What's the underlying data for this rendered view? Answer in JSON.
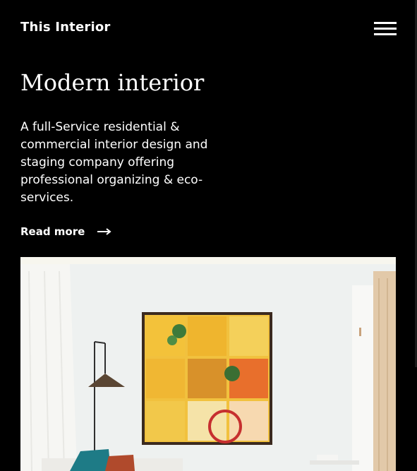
{
  "header": {
    "brand": "This Interior",
    "menu_icon": "hamburger-icon"
  },
  "hero": {
    "title": "Modern interior",
    "description": "A full-Service residential & commercial interior design and staging company offering professional organizing & eco-services.",
    "read_more_label": "Read more",
    "read_more_icon": "arrow-right-icon"
  },
  "image": {
    "subject": "interior-photo"
  },
  "colors": {
    "background": "#000000",
    "text": "#ffffff"
  }
}
